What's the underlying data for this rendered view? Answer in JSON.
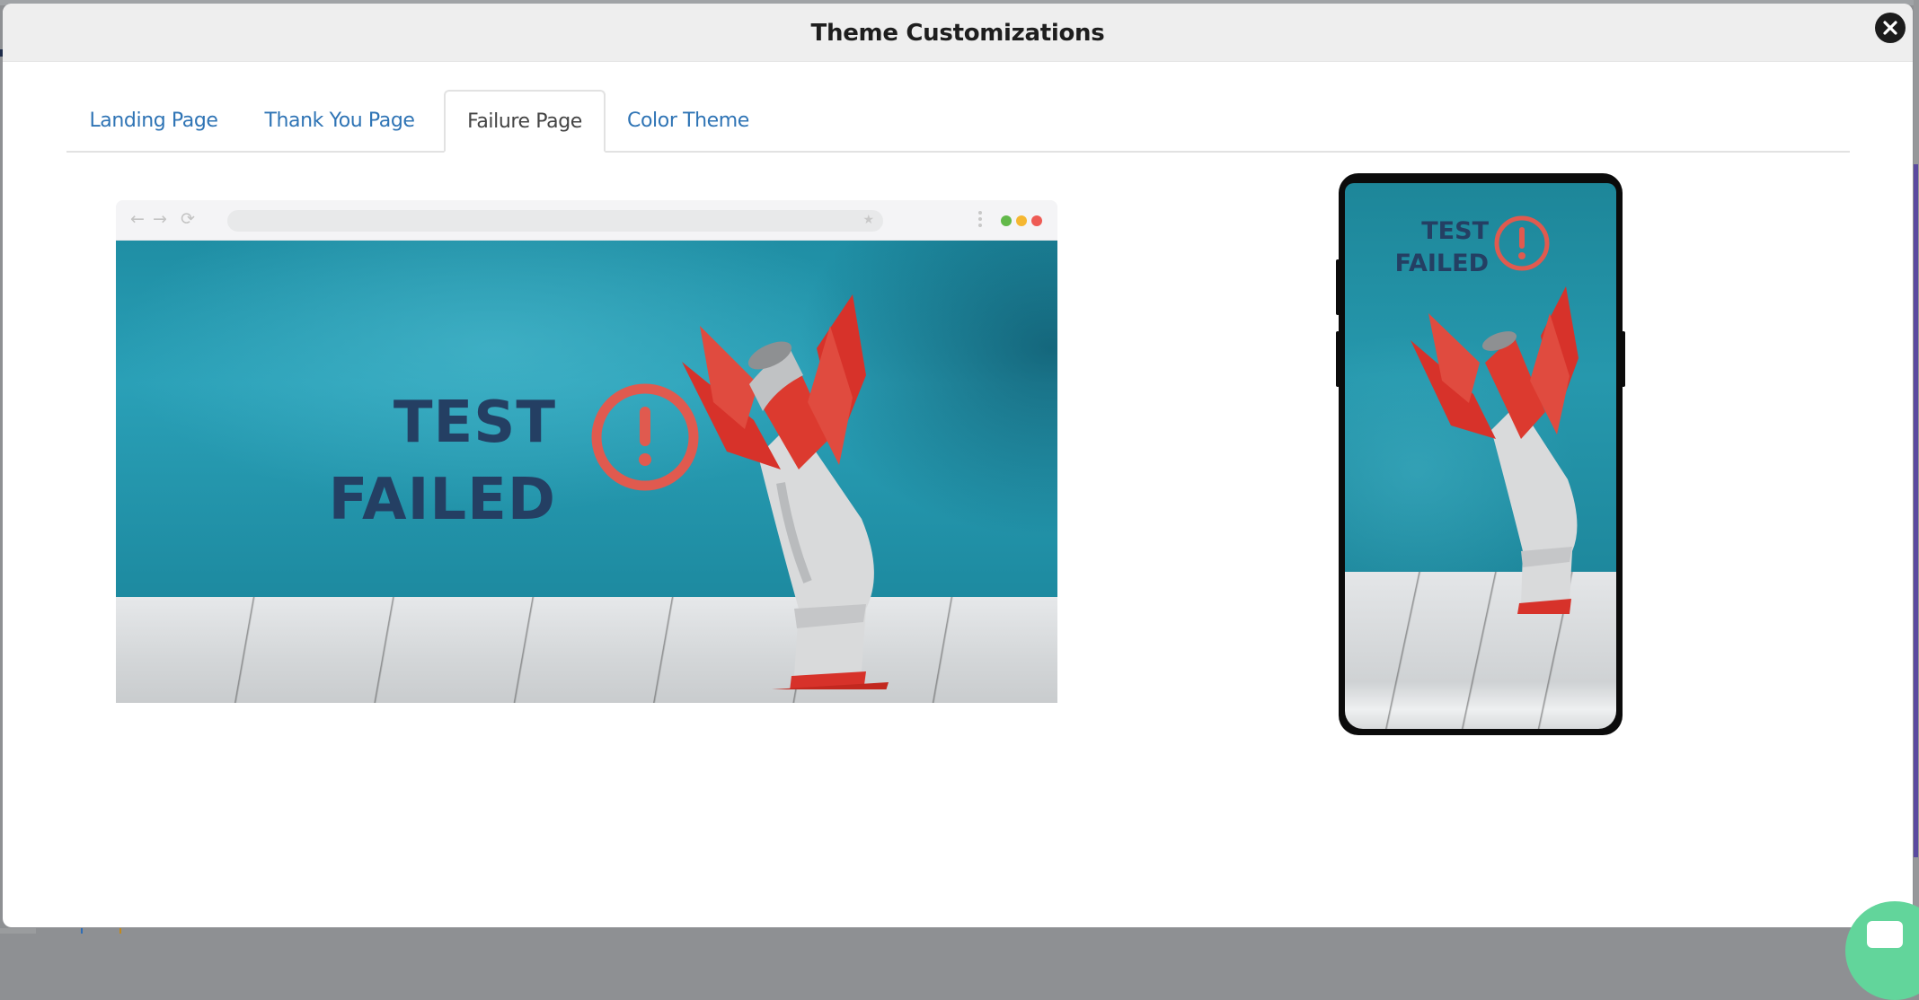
{
  "modal": {
    "title": "Theme Customizations",
    "close_icon": "close-icon"
  },
  "tabs": [
    {
      "label": "Landing Page",
      "active": false
    },
    {
      "label": "Thank You Page",
      "active": false
    },
    {
      "label": "Failure Page",
      "active": true
    },
    {
      "label": "Color Theme",
      "active": false
    }
  ],
  "desktop_preview": {
    "browser_controls": {
      "back_icon": "←",
      "forward_icon": "→",
      "reload_icon": "⟳",
      "bookmark_icon": "★"
    },
    "window_dots": [
      {
        "name": "green",
        "color": "#62b94a"
      },
      {
        "name": "yellow",
        "color": "#f5b731"
      },
      {
        "name": "red",
        "color": "#ee5b55"
      }
    ],
    "headline_line1": "TEST",
    "headline_line2": "FAILED",
    "headline_color": "#243f63",
    "alert_color": "#e05a4f"
  },
  "mobile_preview": {
    "headline_line1": "TEST",
    "headline_line2": "FAILED"
  },
  "colors": {
    "tab_link": "#2f74b5",
    "chat_widget": "#62d59b"
  }
}
